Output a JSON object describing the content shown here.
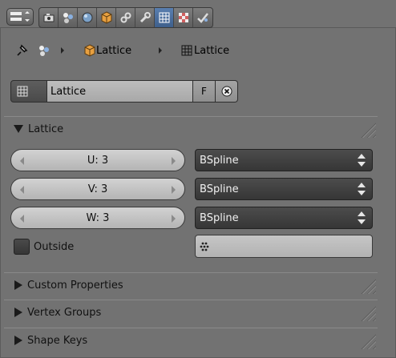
{
  "header": {
    "editor_type_icon": "editor-type-icon",
    "tabs": [
      {
        "icon": "render-icon",
        "active": false
      },
      {
        "icon": "render-layers-icon",
        "active": false
      },
      {
        "icon": "world-icon",
        "active": false
      },
      {
        "icon": "object-icon",
        "active": false
      },
      {
        "icon": "constraints-icon",
        "active": false
      },
      {
        "icon": "modifiers-icon",
        "active": false
      },
      {
        "icon": "lattice-data-icon",
        "active": true
      },
      {
        "icon": "texture-icon",
        "active": false
      },
      {
        "icon": "physics-icon",
        "active": false
      }
    ]
  },
  "breadcrumb": {
    "object_name": "Lattice",
    "data_name": "Lattice"
  },
  "datablock": {
    "name": "Lattice",
    "fake_user_label": "F"
  },
  "panels": {
    "lattice": {
      "title": "Lattice",
      "rows": [
        {
          "field": "U: 3",
          "interpolation": "BSpline"
        },
        {
          "field": "V: 3",
          "interpolation": "BSpline"
        },
        {
          "field": "W: 3",
          "interpolation": "BSpline"
        }
      ],
      "outside_label": "Outside",
      "outside_checked": false,
      "vertex_group": ""
    },
    "custom_properties": {
      "title": "Custom Properties"
    },
    "vertex_groups": {
      "title": "Vertex Groups"
    },
    "shape_keys": {
      "title": "Shape Keys"
    }
  },
  "colors": {
    "background": "#727272",
    "active_tab": "#4a6e9e",
    "object_orange": "#e8a040"
  }
}
